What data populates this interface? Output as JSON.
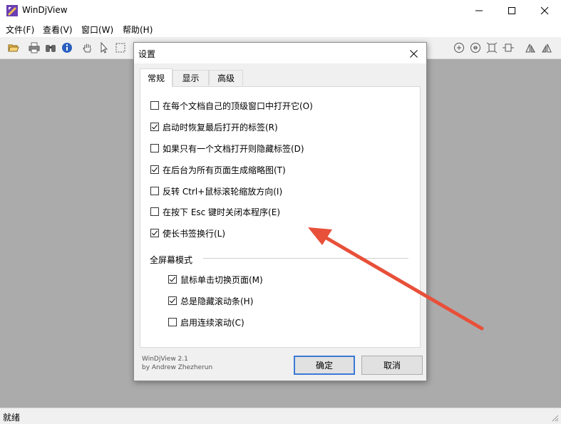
{
  "window": {
    "title": "WinDjView",
    "controls": [
      "minimize",
      "maximize",
      "close"
    ]
  },
  "menu": [
    {
      "label": "文件(F)"
    },
    {
      "label": "查看(V)"
    },
    {
      "label": "窗口(W)"
    },
    {
      "label": "帮助(H)"
    }
  ],
  "toolbar": {
    "icons": [
      "open-icon",
      "print-icon",
      "find-icon",
      "info-icon",
      "hand-icon",
      "select-icon",
      "marquee-icon",
      "zoom-in-icon",
      "zoom-out-icon",
      "fit-page-icon",
      "fit-width-icon",
      "rotate-left-icon",
      "rotate-right-icon"
    ]
  },
  "status": {
    "text": "就绪"
  },
  "dialog": {
    "title": "设置",
    "tabs": [
      {
        "label": "常规",
        "active": true
      },
      {
        "label": "显示",
        "active": false
      },
      {
        "label": "高级",
        "active": false
      }
    ],
    "options": [
      {
        "label": "在每个文档自己的顶级窗口中打开它(O)",
        "checked": false
      },
      {
        "label": "启动时恢复最后打开的标签(R)",
        "checked": true
      },
      {
        "label": "如果只有一个文档打开则隐藏标签(D)",
        "checked": false
      },
      {
        "label": "在后台为所有页面生成缩略图(T)",
        "checked": true
      },
      {
        "label": "反转 Ctrl+鼠标滚轮缩放方向(I)",
        "checked": false
      },
      {
        "label": "在按下 Esc 键时关闭本程序(E)",
        "checked": false
      },
      {
        "label": "使长书签换行(L)",
        "checked": true
      }
    ],
    "fullscreen": {
      "label": "全屏幕模式",
      "options": [
        {
          "label": "鼠标单击切换页面(M)",
          "checked": true
        },
        {
          "label": "总是隐藏滚动条(H)",
          "checked": true
        },
        {
          "label": "启用连续滚动(C)",
          "checked": false
        }
      ]
    },
    "about_line1": "WinDjView 2.1",
    "about_line2": "by Andrew Zhezherun",
    "ok_label": "确定",
    "cancel_label": "取消"
  },
  "colors": {
    "workspace": "#ababab",
    "annotation_arrow": "#e8503a",
    "default_button_border": "#3b79d6"
  }
}
